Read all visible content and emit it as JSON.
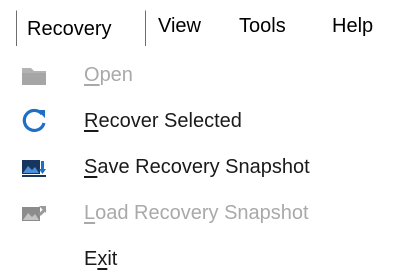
{
  "menubar": {
    "items": [
      {
        "label": "Recovery",
        "open": true
      },
      {
        "label": "View"
      },
      {
        "label": "Tools"
      },
      {
        "label": "Help"
      }
    ]
  },
  "recovery_menu": {
    "items": [
      {
        "mnemonic": "O",
        "rest": "pen",
        "enabled": false,
        "icon": "folder-icon"
      },
      {
        "mnemonic": "R",
        "rest": "ecover Selected",
        "enabled": true,
        "icon": "refresh-icon"
      },
      {
        "mnemonic": "S",
        "rest": "ave Recovery Snapshot",
        "enabled": true,
        "icon": "save-snapshot-icon"
      },
      {
        "mnemonic": "L",
        "rest": "oad Recovery Snapshot",
        "enabled": false,
        "icon": "load-snapshot-icon"
      },
      {
        "prefix": "E",
        "mnemonic": "x",
        "rest": "it",
        "enabled": true,
        "icon": ""
      }
    ]
  },
  "colors": {
    "icon_blue": "#1f6fc5",
    "icon_dark_blue": "#16365f",
    "disabled_gray": "#a9a9a9",
    "menu_separator": "#6e6e6e"
  }
}
